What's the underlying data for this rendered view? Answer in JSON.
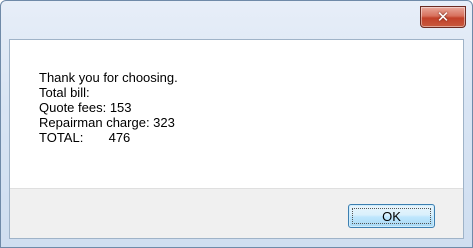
{
  "titlebar": {
    "close_icon": "close-icon",
    "close_glyph": "✕"
  },
  "message": {
    "lines": [
      "Thank you for choosing.",
      "Total bill:",
      "Quote fees: 153",
      "Repairman charge: 323",
      "TOTAL:       476"
    ]
  },
  "buttons": {
    "ok_label": "OK"
  }
}
